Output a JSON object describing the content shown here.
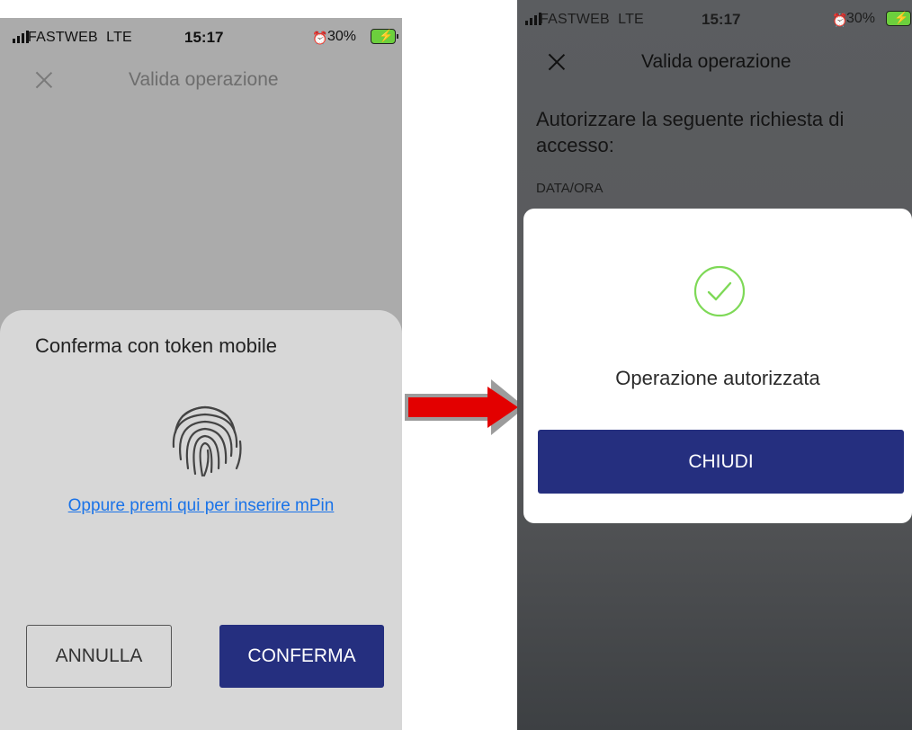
{
  "left_screen": {
    "status_bar": {
      "carrier": "FASTWEB",
      "network": "LTE",
      "time": "15:17",
      "battery": "30%"
    },
    "nav": {
      "title": "Valida operazione"
    },
    "sheet": {
      "title": "Conferma con token mobile",
      "mpin_link": "Oppure premi qui per inserire mPin",
      "cancel_label": "ANNULLA",
      "confirm_label": "CONFERMA"
    }
  },
  "right_screen": {
    "status_bar": {
      "carrier": "FASTWEB",
      "network": "LTE",
      "time": "15:17",
      "battery": "30%"
    },
    "nav": {
      "title": "Valida operazione"
    },
    "request": {
      "title": "Autorizzare la seguente richiesta di accesso:",
      "field_label": "DATA/ORA"
    },
    "dialog": {
      "message": "Operazione autorizzata",
      "close_label": "CHIUDI"
    }
  },
  "icons": [
    "signal-bars-icon",
    "alarm-icon",
    "battery-charging-icon",
    "close-icon",
    "fingerprint-icon",
    "check-circle-icon",
    "arrow-right-icon"
  ],
  "colors": {
    "primary_button": "#252f7f",
    "link": "#1a73e8",
    "check": "#7ed957",
    "arrow": "#e30000",
    "sheet_bg": "#d7d7d7",
    "left_dim_bg": "#ababab"
  }
}
